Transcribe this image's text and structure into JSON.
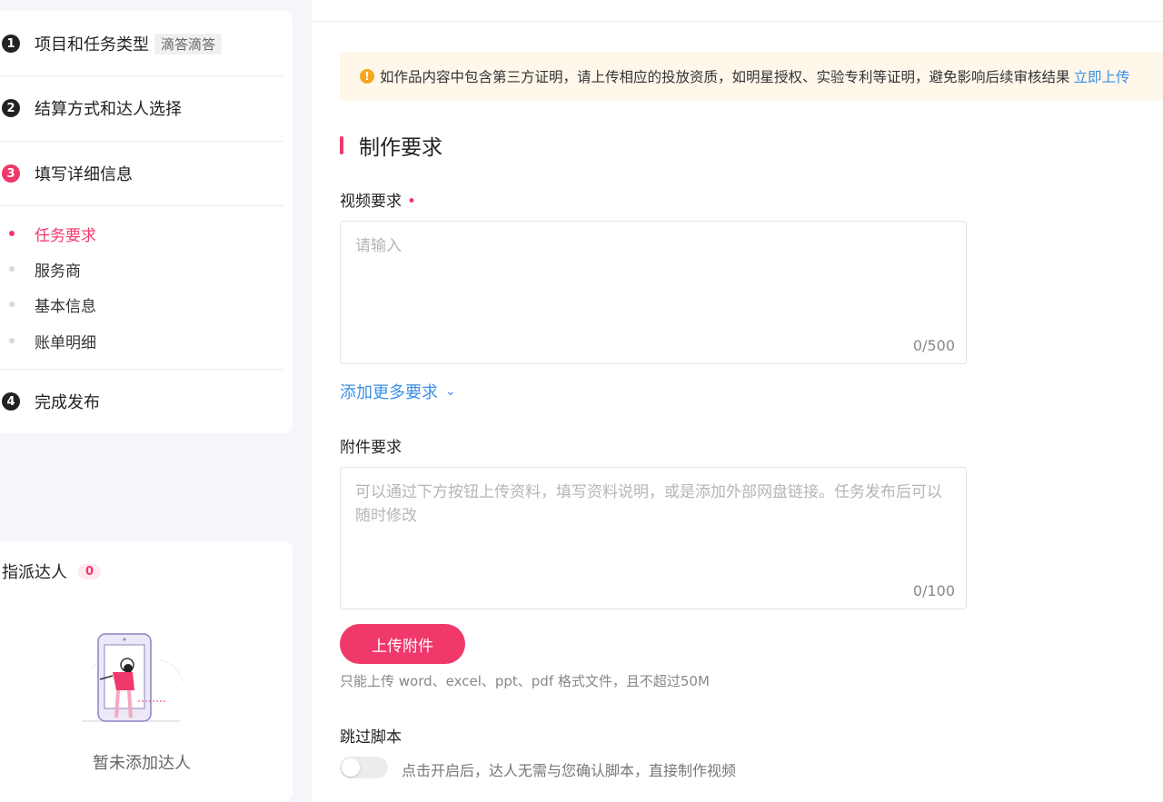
{
  "steps": [
    {
      "num": "1",
      "label": "项目和任务类型",
      "tag": "滴答滴答"
    },
    {
      "num": "2",
      "label": "结算方式和达人选择"
    },
    {
      "num": "3",
      "label": "填写详细信息"
    },
    {
      "num": "4",
      "label": "完成发布"
    }
  ],
  "sub_items": [
    {
      "label": "任务要求",
      "active": true
    },
    {
      "label": "服务商"
    },
    {
      "label": "基本信息"
    },
    {
      "label": "账单明细"
    }
  ],
  "assign": {
    "title": "指派达人",
    "count": "0",
    "empty_text": "暂未添加达人"
  },
  "notice": {
    "text": "如作品内容中包含第三方证明，请上传相应的投放资质，如明星授权、实验专利等证明，避免影响后续审核结果",
    "link": "立即上传",
    "icon": "!"
  },
  "section_title": "制作要求",
  "video_req": {
    "label": "视频要求",
    "required_mark": "•",
    "placeholder": "请输入",
    "counter": "0/500"
  },
  "more_link": {
    "label": "添加更多要求",
    "icon": "chevron-down-icon",
    "glyph": "⌄"
  },
  "attachment": {
    "label": "附件要求",
    "placeholder": "可以通过下方按钮上传资料，填写资料说明，或是添加外部网盘链接。任务发布后可以随时修改",
    "counter": "0/100"
  },
  "upload": {
    "button": "上传附件",
    "hint": "只能上传 word、excel、ppt、pdf 格式文件，且不超过50M"
  },
  "skip_script": {
    "label": "跳过脚本",
    "desc": "点击开启后，达人无需与您确认脚本，直接制作视频",
    "enabled": false
  },
  "colors": {
    "accent": "#f0386b",
    "link": "#3a8ee6",
    "notice_bg": "#fef7ea"
  }
}
